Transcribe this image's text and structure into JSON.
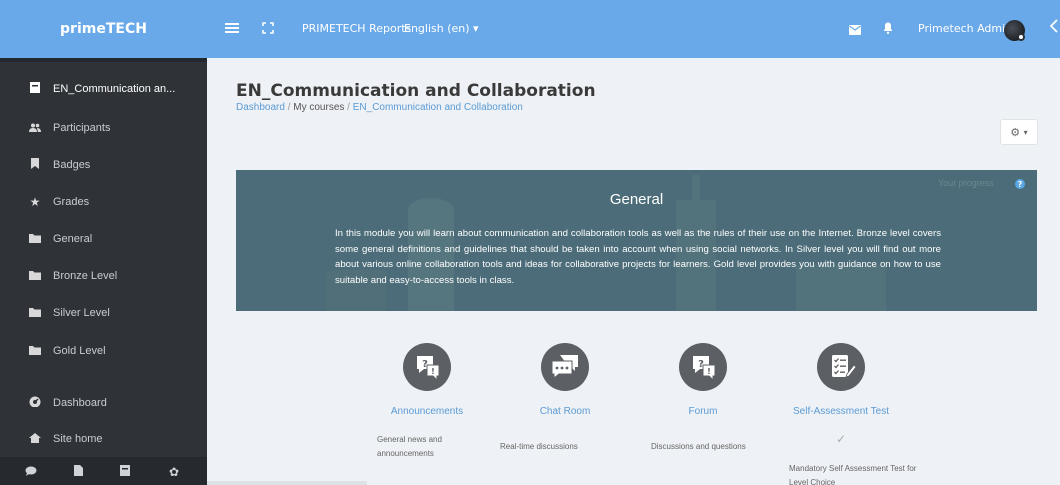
{
  "app": {
    "brand": "primeTECH",
    "reports_link": "PRIMETECH Reports",
    "language": "English (en)",
    "user_name": "Primetech Admin"
  },
  "topbar_icons": [
    "menu-icon",
    "fullscreen-icon",
    "mail-icon",
    "bell-icon",
    "collapse-arrow-icon"
  ],
  "sidebar": {
    "items": [
      {
        "label": "EN_Communication an...",
        "icon": "book-icon",
        "active": true
      },
      {
        "label": "Participants",
        "icon": "users-icon"
      },
      {
        "label": "Badges",
        "icon": "bookmark-icon"
      },
      {
        "label": "Grades",
        "icon": "star-icon"
      },
      {
        "label": "General",
        "icon": "folder-icon"
      },
      {
        "label": "Bronze Level",
        "icon": "folder-icon"
      },
      {
        "label": "Silver Level",
        "icon": "folder-icon"
      },
      {
        "label": "Gold Level",
        "icon": "folder-icon"
      },
      {
        "label": "Dashboard",
        "icon": "dashboard-icon"
      },
      {
        "label": "Site home",
        "icon": "home-icon"
      }
    ],
    "bottom_icons": [
      "chat-icon",
      "file-icon",
      "book-icon",
      "gear-icon"
    ]
  },
  "page": {
    "title": "EN_Communication and Collaboration",
    "breadcrumb": {
      "dashboard": "Dashboard",
      "sep": " / ",
      "my_courses": "My courses",
      "course": "EN_Communication and Collaboration"
    }
  },
  "section": {
    "title": "General",
    "progress_label": "Your progress",
    "description": "In this module you will learn about communication and collaboration tools as well as the rules of their use on the Internet. Bronze level covers some general definitions and guidelines that should be taken into account when using social networks. In Silver level you will find out more about various online collaboration tools and ideas for collaborative projects for learners. Gold level provides you with guidance on how to use suitable and easy-to-access tools in class."
  },
  "activities": [
    {
      "name": "Announcements",
      "description": "General news and announcements",
      "icon": "forum-question-icon"
    },
    {
      "name": "Chat Room",
      "description": "Real-time discussions",
      "icon": "chat-icon"
    },
    {
      "name": "Forum",
      "description": "Discussions and questions",
      "icon": "forum-question-icon"
    },
    {
      "name": "Self-Assessment Test",
      "description": "Mandatory Self Assessment Test for Level Choice",
      "icon": "checklist-icon",
      "completion": "check-icon"
    }
  ],
  "colors": {
    "topbar": "#6aa9e9",
    "sidebar": "#2f3338",
    "banner": "#4b6c78",
    "link": "#5b9bd5",
    "activity_icon": "#5c5f63"
  }
}
